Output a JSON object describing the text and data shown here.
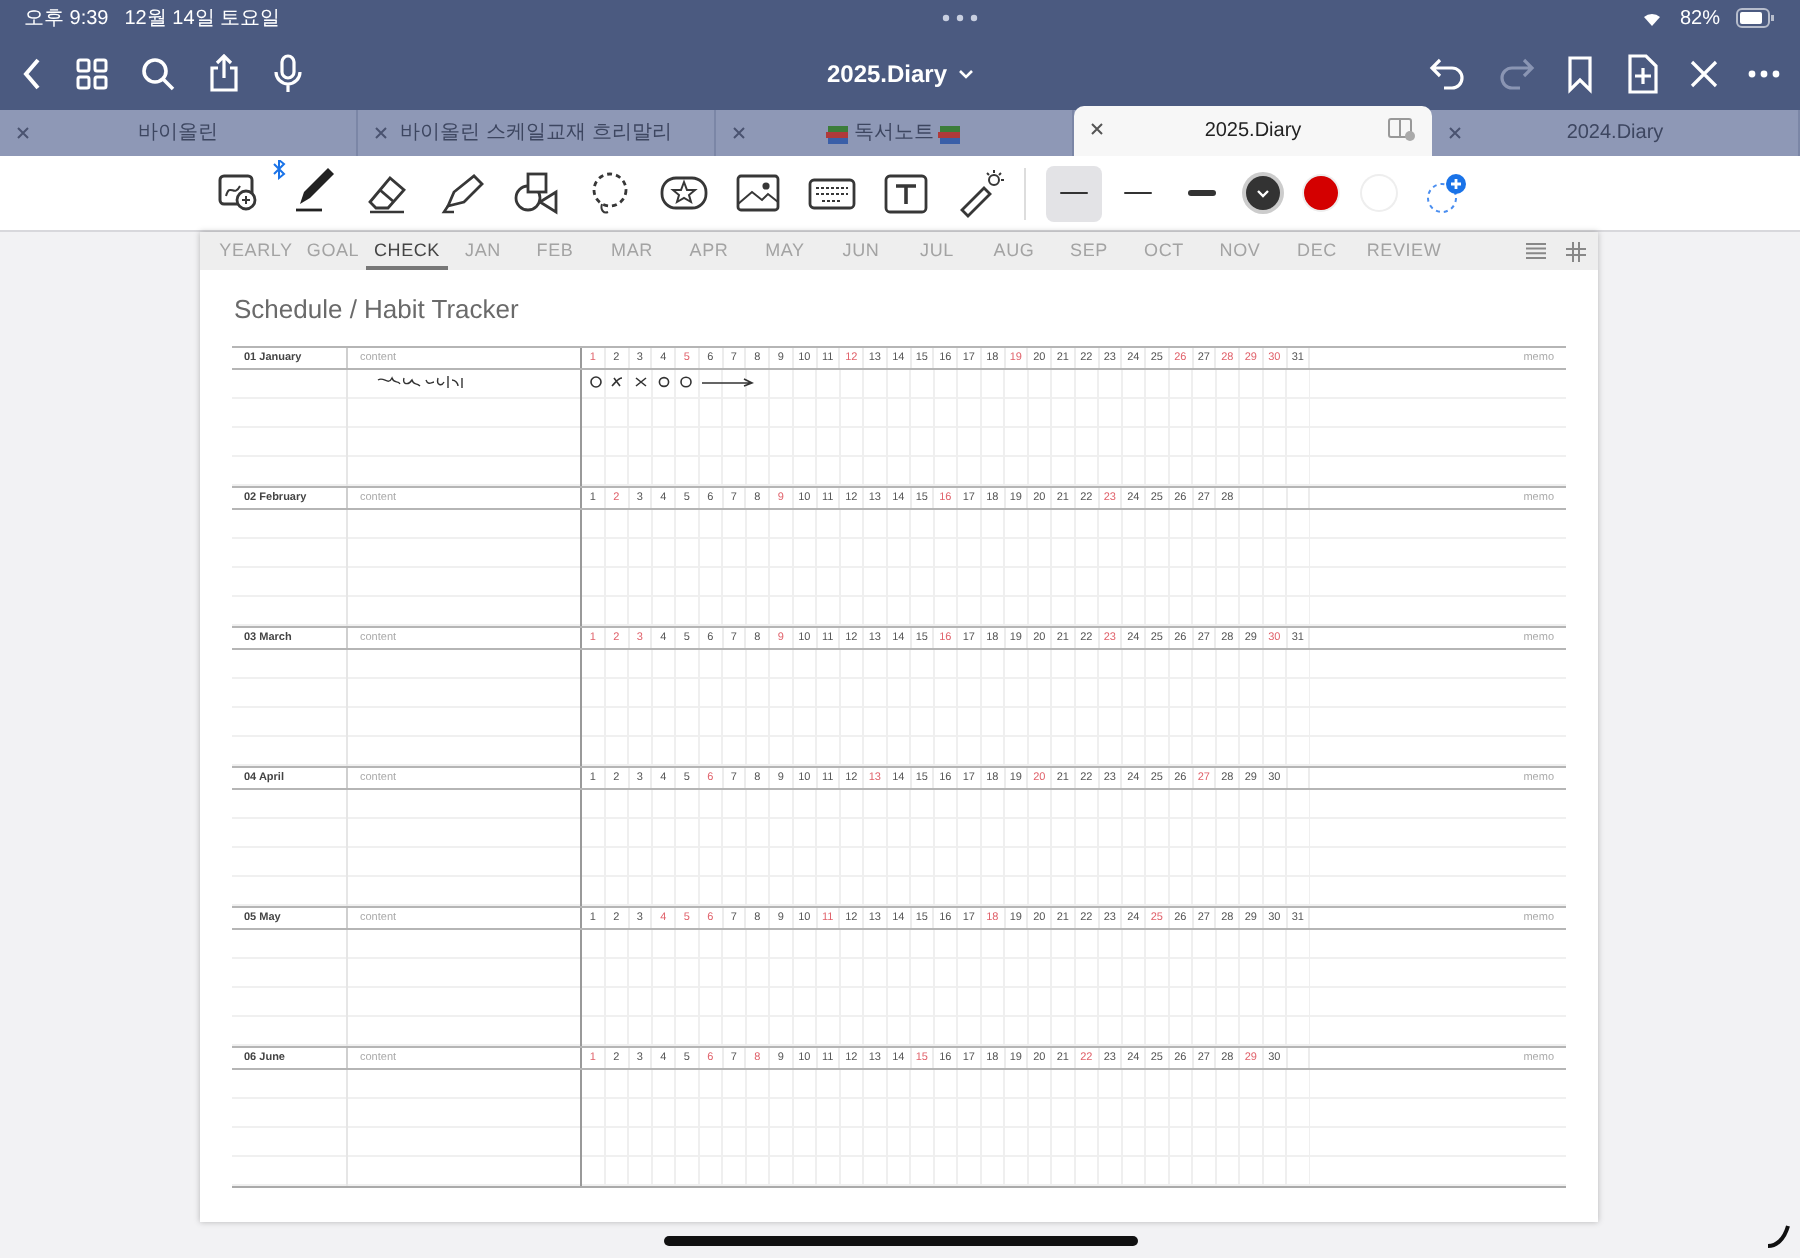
{
  "status_bar": {
    "time": "오후 9:39",
    "date": "12월 14일 토요일",
    "battery": "82%"
  },
  "nav_bar": {
    "title": "2025.Diary"
  },
  "doc_tabs": [
    {
      "label": "바이올린",
      "selected": false,
      "books": false
    },
    {
      "label": "바이올린 스케일교재 흐리말리",
      "selected": false,
      "books": false
    },
    {
      "label": "독서노트",
      "selected": false,
      "books": true
    },
    {
      "label": "2025.Diary",
      "selected": true,
      "books": false
    },
    {
      "label": "2024.Diary",
      "selected": false,
      "books": false
    }
  ],
  "tools": [
    {
      "kind": "zoom",
      "selected": false
    },
    {
      "kind": "pen",
      "selected": true
    },
    {
      "kind": "eraser",
      "selected": false
    },
    {
      "kind": "highlighter",
      "selected": false
    },
    {
      "kind": "shapes",
      "selected": false
    },
    {
      "kind": "lasso",
      "selected": false
    },
    {
      "kind": "sticker",
      "selected": false
    },
    {
      "kind": "image",
      "selected": false
    },
    {
      "kind": "keyboard",
      "selected": false
    },
    {
      "kind": "text",
      "selected": false
    },
    {
      "kind": "laser",
      "selected": false
    }
  ],
  "widths": [
    {
      "selected": true
    },
    {
      "selected": false
    },
    {
      "selected": false
    }
  ],
  "colors": [
    {
      "color": "#333333",
      "selected": true
    },
    {
      "color": "#d40000",
      "selected": false
    },
    {
      "color": "#ffffff",
      "selected": false
    }
  ],
  "page_tabs": [
    {
      "label": "YEARLY",
      "selected": false
    },
    {
      "label": "GOAL",
      "selected": false
    },
    {
      "label": "CHECK",
      "selected": true
    },
    {
      "label": "JAN",
      "selected": false
    },
    {
      "label": "FEB",
      "selected": false
    },
    {
      "label": "MAR",
      "selected": false
    },
    {
      "label": "APR",
      "selected": false
    },
    {
      "label": "MAY",
      "selected": false
    },
    {
      "label": "JUN",
      "selected": false
    },
    {
      "label": "JUL",
      "selected": false
    },
    {
      "label": "AUG",
      "selected": false
    },
    {
      "label": "SEP",
      "selected": false
    },
    {
      "label": "OCT",
      "selected": false
    },
    {
      "label": "NOV",
      "selected": false
    },
    {
      "label": "DEC",
      "selected": false
    },
    {
      "label": "REVIEW",
      "selected": false
    }
  ],
  "page_title": "Schedule / Habit Tracker",
  "months": [
    {
      "label": "01 January",
      "content": "content",
      "memo": "memo",
      "ink": true,
      "days": [
        {
          "n": "1",
          "red": true
        },
        {
          "n": "2",
          "red": false
        },
        {
          "n": "3",
          "red": false
        },
        {
          "n": "4",
          "red": false
        },
        {
          "n": "5",
          "red": true
        },
        {
          "n": "6",
          "red": false
        },
        {
          "n": "7",
          "red": false
        },
        {
          "n": "8",
          "red": false
        },
        {
          "n": "9",
          "red": false
        },
        {
          "n": "10",
          "red": false
        },
        {
          "n": "11",
          "red": false
        },
        {
          "n": "12",
          "red": true
        },
        {
          "n": "13",
          "red": false
        },
        {
          "n": "14",
          "red": false
        },
        {
          "n": "15",
          "red": false
        },
        {
          "n": "16",
          "red": false
        },
        {
          "n": "17",
          "red": false
        },
        {
          "n": "18",
          "red": false
        },
        {
          "n": "19",
          "red": true
        },
        {
          "n": "20",
          "red": false
        },
        {
          "n": "21",
          "red": false
        },
        {
          "n": "22",
          "red": false
        },
        {
          "n": "23",
          "red": false
        },
        {
          "n": "24",
          "red": false
        },
        {
          "n": "25",
          "red": false
        },
        {
          "n": "26",
          "red": true
        },
        {
          "n": "27",
          "red": false
        },
        {
          "n": "28",
          "red": true
        },
        {
          "n": "29",
          "red": true
        },
        {
          "n": "30",
          "red": true
        },
        {
          "n": "31",
          "red": false
        }
      ]
    },
    {
      "label": "02 February",
      "content": "content",
      "memo": "memo",
      "ink": false,
      "days": [
        {
          "n": "1",
          "red": false
        },
        {
          "n": "2",
          "red": true
        },
        {
          "n": "3",
          "red": false
        },
        {
          "n": "4",
          "red": false
        },
        {
          "n": "5",
          "red": false
        },
        {
          "n": "6",
          "red": false
        },
        {
          "n": "7",
          "red": false
        },
        {
          "n": "8",
          "red": false
        },
        {
          "n": "9",
          "red": true
        },
        {
          "n": "10",
          "red": false
        },
        {
          "n": "11",
          "red": false
        },
        {
          "n": "12",
          "red": false
        },
        {
          "n": "13",
          "red": false
        },
        {
          "n": "14",
          "red": false
        },
        {
          "n": "15",
          "red": false
        },
        {
          "n": "16",
          "red": true
        },
        {
          "n": "17",
          "red": false
        },
        {
          "n": "18",
          "red": false
        },
        {
          "n": "19",
          "red": false
        },
        {
          "n": "20",
          "red": false
        },
        {
          "n": "21",
          "red": false
        },
        {
          "n": "22",
          "red": false
        },
        {
          "n": "23",
          "red": true
        },
        {
          "n": "24",
          "red": false
        },
        {
          "n": "25",
          "red": false
        },
        {
          "n": "26",
          "red": false
        },
        {
          "n": "27",
          "red": false
        },
        {
          "n": "28",
          "red": false
        }
      ]
    },
    {
      "label": "03 March",
      "content": "content",
      "memo": "memo",
      "ink": false,
      "days": [
        {
          "n": "1",
          "red": true
        },
        {
          "n": "2",
          "red": true
        },
        {
          "n": "3",
          "red": true
        },
        {
          "n": "4",
          "red": false
        },
        {
          "n": "5",
          "red": false
        },
        {
          "n": "6",
          "red": false
        },
        {
          "n": "7",
          "red": false
        },
        {
          "n": "8",
          "red": false
        },
        {
          "n": "9",
          "red": true
        },
        {
          "n": "10",
          "red": false
        },
        {
          "n": "11",
          "red": false
        },
        {
          "n": "12",
          "red": false
        },
        {
          "n": "13",
          "red": false
        },
        {
          "n": "14",
          "red": false
        },
        {
          "n": "15",
          "red": false
        },
        {
          "n": "16",
          "red": true
        },
        {
          "n": "17",
          "red": false
        },
        {
          "n": "18",
          "red": false
        },
        {
          "n": "19",
          "red": false
        },
        {
          "n": "20",
          "red": false
        },
        {
          "n": "21",
          "red": false
        },
        {
          "n": "22",
          "red": false
        },
        {
          "n": "23",
          "red": true
        },
        {
          "n": "24",
          "red": false
        },
        {
          "n": "25",
          "red": false
        },
        {
          "n": "26",
          "red": false
        },
        {
          "n": "27",
          "red": false
        },
        {
          "n": "28",
          "red": false
        },
        {
          "n": "29",
          "red": false
        },
        {
          "n": "30",
          "red": true
        },
        {
          "n": "31",
          "red": false
        }
      ]
    },
    {
      "label": "04 April",
      "content": "content",
      "memo": "memo",
      "ink": false,
      "days": [
        {
          "n": "1",
          "red": false
        },
        {
          "n": "2",
          "red": false
        },
        {
          "n": "3",
          "red": false
        },
        {
          "n": "4",
          "red": false
        },
        {
          "n": "5",
          "red": false
        },
        {
          "n": "6",
          "red": true
        },
        {
          "n": "7",
          "red": false
        },
        {
          "n": "8",
          "red": false
        },
        {
          "n": "9",
          "red": false
        },
        {
          "n": "10",
          "red": false
        },
        {
          "n": "11",
          "red": false
        },
        {
          "n": "12",
          "red": false
        },
        {
          "n": "13",
          "red": true
        },
        {
          "n": "14",
          "red": false
        },
        {
          "n": "15",
          "red": false
        },
        {
          "n": "16",
          "red": false
        },
        {
          "n": "17",
          "red": false
        },
        {
          "n": "18",
          "red": false
        },
        {
          "n": "19",
          "red": false
        },
        {
          "n": "20",
          "red": true
        },
        {
          "n": "21",
          "red": false
        },
        {
          "n": "22",
          "red": false
        },
        {
          "n": "23",
          "red": false
        },
        {
          "n": "24",
          "red": false
        },
        {
          "n": "25",
          "red": false
        },
        {
          "n": "26",
          "red": false
        },
        {
          "n": "27",
          "red": true
        },
        {
          "n": "28",
          "red": false
        },
        {
          "n": "29",
          "red": false
        },
        {
          "n": "30",
          "red": false
        }
      ]
    },
    {
      "label": "05 May",
      "content": "content",
      "memo": "memo",
      "ink": false,
      "days": [
        {
          "n": "1",
          "red": false
        },
        {
          "n": "2",
          "red": false
        },
        {
          "n": "3",
          "red": false
        },
        {
          "n": "4",
          "red": true
        },
        {
          "n": "5",
          "red": true
        },
        {
          "n": "6",
          "red": true
        },
        {
          "n": "7",
          "red": false
        },
        {
          "n": "8",
          "red": false
        },
        {
          "n": "9",
          "red": false
        },
        {
          "n": "10",
          "red": false
        },
        {
          "n": "11",
          "red": true
        },
        {
          "n": "12",
          "red": false
        },
        {
          "n": "13",
          "red": false
        },
        {
          "n": "14",
          "red": false
        },
        {
          "n": "15",
          "red": false
        },
        {
          "n": "16",
          "red": false
        },
        {
          "n": "17",
          "red": false
        },
        {
          "n": "18",
          "red": true
        },
        {
          "n": "19",
          "red": false
        },
        {
          "n": "20",
          "red": false
        },
        {
          "n": "21",
          "red": false
        },
        {
          "n": "22",
          "red": false
        },
        {
          "n": "23",
          "red": false
        },
        {
          "n": "24",
          "red": false
        },
        {
          "n": "25",
          "red": true
        },
        {
          "n": "26",
          "red": false
        },
        {
          "n": "27",
          "red": false
        },
        {
          "n": "28",
          "red": false
        },
        {
          "n": "29",
          "red": false
        },
        {
          "n": "30",
          "red": false
        },
        {
          "n": "31",
          "red": false
        }
      ]
    },
    {
      "label": "06 June",
      "content": "content",
      "memo": "memo",
      "ink": false,
      "days": [
        {
          "n": "1",
          "red": true
        },
        {
          "n": "2",
          "red": false
        },
        {
          "n": "3",
          "red": false
        },
        {
          "n": "4",
          "red": false
        },
        {
          "n": "5",
          "red": false
        },
        {
          "n": "6",
          "red": true
        },
        {
          "n": "7",
          "red": false
        },
        {
          "n": "8",
          "red": true
        },
        {
          "n": "9",
          "red": false
        },
        {
          "n": "10",
          "red": false
        },
        {
          "n": "11",
          "red": false
        },
        {
          "n": "12",
          "red": false
        },
        {
          "n": "13",
          "red": false
        },
        {
          "n": "14",
          "red": false
        },
        {
          "n": "15",
          "red": true
        },
        {
          "n": "16",
          "red": false
        },
        {
          "n": "17",
          "red": false
        },
        {
          "n": "18",
          "red": false
        },
        {
          "n": "19",
          "red": false
        },
        {
          "n": "20",
          "red": false
        },
        {
          "n": "21",
          "red": false
        },
        {
          "n": "22",
          "red": true
        },
        {
          "n": "23",
          "red": false
        },
        {
          "n": "24",
          "red": false
        },
        {
          "n": "25",
          "red": false
        },
        {
          "n": "26",
          "red": false
        },
        {
          "n": "27",
          "red": false
        },
        {
          "n": "28",
          "red": false
        },
        {
          "n": "29",
          "red": true
        },
        {
          "n": "30",
          "red": false
        }
      ]
    }
  ]
}
